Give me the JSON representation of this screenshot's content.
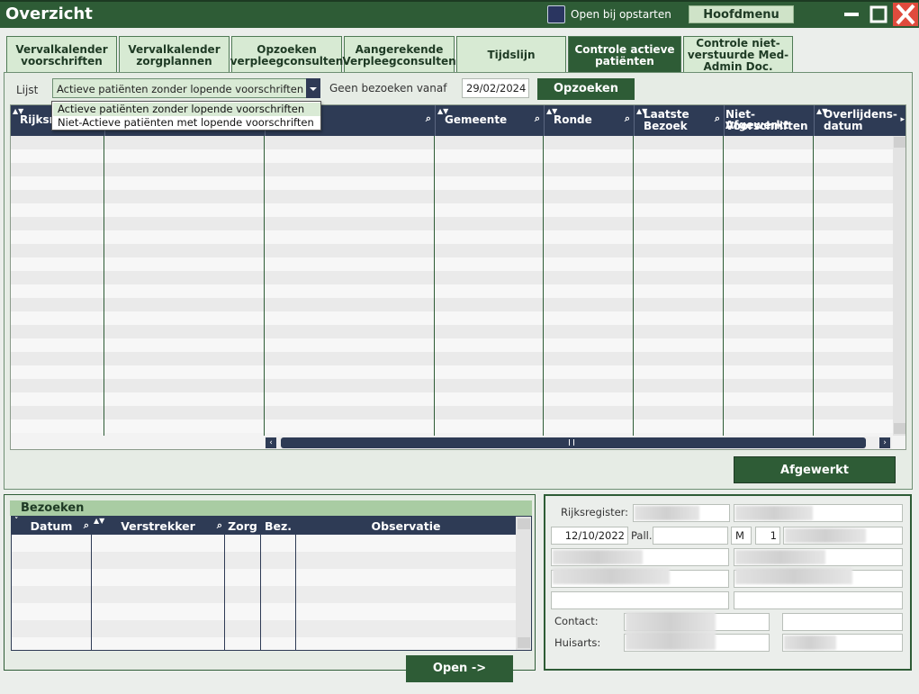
{
  "window": {
    "title": "Overzicht",
    "open_bij_opstarten_label": "Open bij opstarten",
    "hoofdmenu_label": "Hoofdmenu"
  },
  "tabs": [
    {
      "label": "Vervalkalender voorschriften",
      "active": false
    },
    {
      "label": "Vervalkalender zorgplannen",
      "active": false
    },
    {
      "label": "Opzoeken verpleegconsulten",
      "active": false
    },
    {
      "label": "Aangerekende Verpleegconsulten",
      "active": false
    },
    {
      "label": "Tijdslijn",
      "active": false
    },
    {
      "label": "Controle actieve patiënten",
      "active": true
    },
    {
      "label": "Controle niet-verstuurde Med-Admin Doc.",
      "active": false
    }
  ],
  "filter": {
    "lijst_label": "Lijst",
    "lijst_value": "Actieve patiënten zonder lopende voorschriften",
    "lijst_options": [
      "Actieve patiënten zonder lopende voorschriften",
      "Niet-Actieve patiënten met lopende voorschriften"
    ],
    "geen_bezoeken_label": "Geen bezoeken vanaf",
    "date_value": "29/02/2024",
    "search_button": "Opzoeken"
  },
  "grid": {
    "columns": [
      {
        "label": "Rijksr",
        "sub": ""
      },
      {
        "label": "",
        "sub": ""
      },
      {
        "label": "",
        "sub": ""
      },
      {
        "label": "Gemeente",
        "sub": ""
      },
      {
        "label": "Ronde",
        "sub": ""
      },
      {
        "label": "Laatste",
        "sub": "Bezoek"
      },
      {
        "label": "Niet-Afgewerkt",
        "sub": "Voorschriften"
      },
      {
        "label": "Overlijdens-",
        "sub": "datum"
      }
    ],
    "rows": []
  },
  "afgewerkt_button": "Afgewerkt",
  "bezoeken": {
    "title": "Bezoeken",
    "columns": [
      "Datum",
      "Verstrekker",
      "Zorg",
      "Bez.",
      "Observatie"
    ],
    "rows": [],
    "open_button": "Open ->"
  },
  "patient": {
    "rijksregister_label": "Rijksregister:",
    "date_value": "12/10/2022",
    "pall_label": "Pall.",
    "gender_value": "M",
    "number_value": "1",
    "contact_label": "Contact:",
    "huisarts_label": "Huisarts:"
  },
  "colors": {
    "primary_green": "#2e5c36",
    "header_navy": "#2e3b55",
    "tab_light": "#d7ead3",
    "close_red": "#e04b3d"
  }
}
